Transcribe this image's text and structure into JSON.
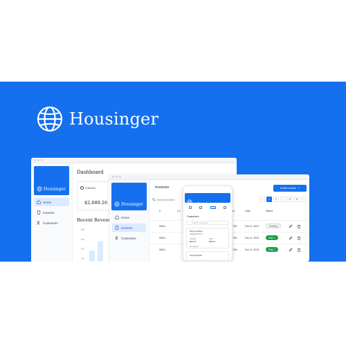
{
  "brand": {
    "name": "Housinger"
  },
  "colors": {
    "primary": "#1570ef",
    "paid": "#16a34a",
    "active_nav": "#dbeafe"
  },
  "dashboard": {
    "title": "Dashboard",
    "nav": [
      {
        "label": "Home",
        "icon": "home-icon"
      },
      {
        "label": "Invoices",
        "icon": "invoice-icon"
      },
      {
        "label": "Customers",
        "icon": "users-icon"
      }
    ],
    "collected_label": "Collected",
    "collected_value": "$2,689.26",
    "recent_revenue_title": "Recent Revenue",
    "y_axis": [
      "$5k",
      "$4k",
      "$3k",
      "$2k"
    ]
  },
  "invoices": {
    "title": "Invoices",
    "create_label": "Create Invoice",
    "search_placeholder": "Search invoices",
    "pages": [
      "1",
      "2",
      "...",
      "5",
      "6"
    ],
    "columns": {
      "id": "#",
      "customer": "Cu",
      "amount": "ount",
      "date": "Date",
      "status": "Status"
    },
    "rows": [
      {
        "id": "9564...",
        "amount": "5768",
        "date": "Dec 6, 2022",
        "status": "Pending"
      },
      {
        "id": "9564...",
        "amount": "5768",
        "date": "Dec 6, 2022",
        "status": "Paid"
      },
      {
        "id": "9564...",
        "amount": "5768",
        "date": "Dec 6, 2022",
        "status": "Paid"
      }
    ]
  },
  "phone": {
    "section_title": "Customers",
    "search_placeholder": "Search customers",
    "customer_name": "Kelly & customer",
    "customer_email": "kelly@delba.com",
    "pending_label": "Pending",
    "pending_value": "$229.44",
    "paid_label": "Paid",
    "paid_value": "$320.21",
    "invoices_label": "12 invoices",
    "second_customer": "Christy Douglas"
  }
}
